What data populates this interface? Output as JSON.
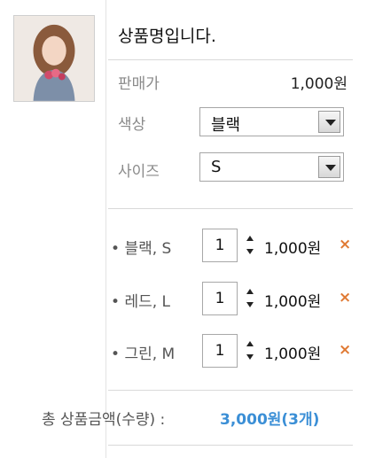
{
  "product": {
    "name": "상품명입니다.",
    "image_icon": "product-photo"
  },
  "price": {
    "label": "판매가",
    "value": "1,000원"
  },
  "color_select": {
    "label": "색상",
    "value": "블랙"
  },
  "size_select": {
    "label": "사이즈",
    "value": "S"
  },
  "selected_options": [
    {
      "name": "블랙, S",
      "qty": "1",
      "price": "1,000원",
      "remove": "×"
    },
    {
      "name": "레드, L",
      "qty": "1",
      "price": "1,000원",
      "remove": "×"
    },
    {
      "name": "그린, M",
      "qty": "1",
      "price": "1,000원",
      "remove": "×"
    }
  ],
  "total": {
    "label": "총 상품금액(수량) :",
    "value": "3,000원(3개)"
  },
  "colors": {
    "remove": "#e07a34",
    "total_value": "#3b8fd6",
    "divider": "#d9d9d9"
  }
}
